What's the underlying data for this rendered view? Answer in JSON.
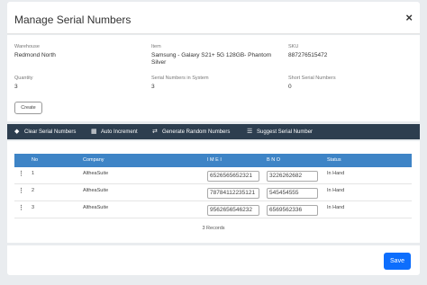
{
  "modal": {
    "title": "Manage Serial Numbers",
    "close_icon": "×"
  },
  "info": {
    "warehouse": {
      "label": "Warehouse",
      "value": "Redmond North"
    },
    "item": {
      "label": "Item",
      "value": "Samsung - Galaxy S21+ 5G 128GB- Phantom Silver"
    },
    "sku": {
      "label": "SKU",
      "value": "887276515472"
    },
    "quantity": {
      "label": "Quantity",
      "value": "3"
    },
    "serials_in_system": {
      "label": "Serial Numbers in System",
      "value": "3"
    },
    "short_serials": {
      "label": "Short Serial Numbers",
      "value": "0"
    },
    "create_label": "Create"
  },
  "toolbar": {
    "items": [
      {
        "icon": "eraser-icon",
        "glyph": "◆",
        "label": "Clear Serial Numbers"
      },
      {
        "icon": "keyboard-icon",
        "glyph": "▦",
        "label": "Auto Increment"
      },
      {
        "icon": "shuffle-icon",
        "glyph": "⇄",
        "label": "Generate Random Numbers"
      },
      {
        "icon": "list-icon",
        "glyph": "☰",
        "label": "Suggest Serial Number"
      }
    ]
  },
  "table": {
    "headers": [
      "No",
      "Company",
      "I M E I",
      "B N O",
      "Status"
    ],
    "rows": [
      {
        "no": "1",
        "company": "AltheaSuite",
        "imei": "6526565652321",
        "bno": "3226262682",
        "status": "In Hand"
      },
      {
        "no": "2",
        "company": "AltheaSuite",
        "imei": "78784112235121",
        "bno": "545454555",
        "status": "In Hand"
      },
      {
        "no": "3",
        "company": "AltheaSuite",
        "imei": "9562656546232",
        "bno": "6569562336",
        "status": "In Hand"
      }
    ],
    "records_text": "3 Records"
  },
  "footer": {
    "save_label": "Save"
  },
  "colors": {
    "toolbar_bg": "#2d3e4f",
    "table_header_bg": "#3e84c6",
    "save_bg": "#0d6efd"
  }
}
